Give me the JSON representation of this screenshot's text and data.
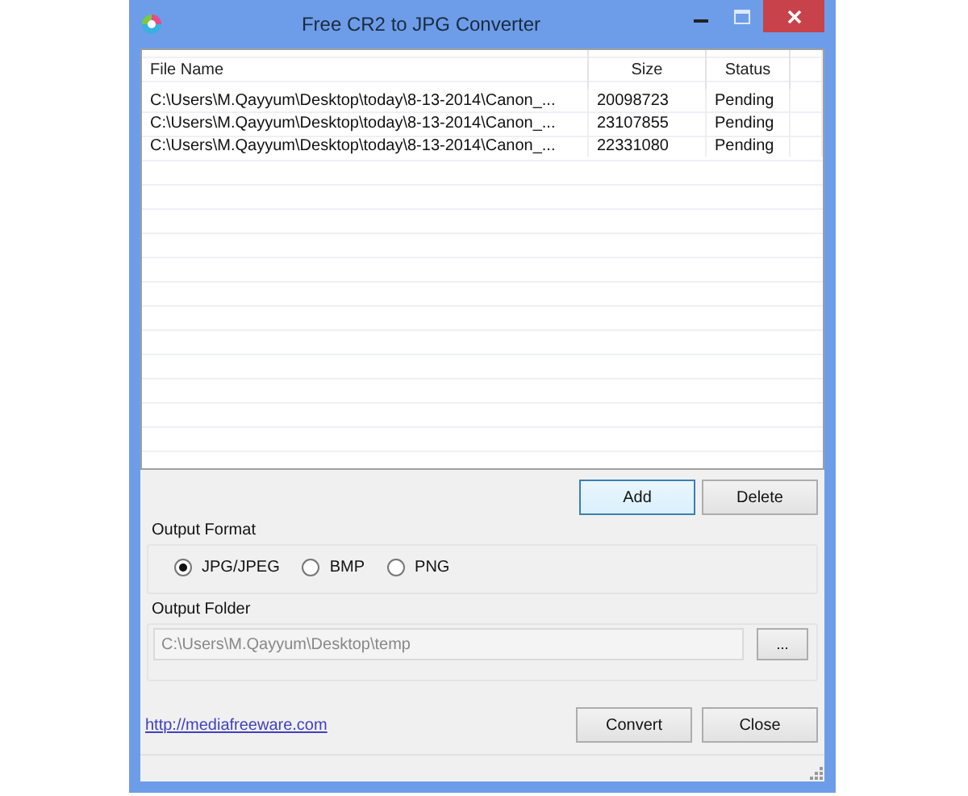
{
  "window": {
    "title": "Free CR2 to JPG Converter"
  },
  "table": {
    "columns": [
      "File Name",
      "Size",
      "Status"
    ],
    "rows": [
      [
        "C:\\Users\\M.Qayyum\\Desktop\\today\\8-13-2014\\Canon_...",
        "20098723",
        "Pending"
      ],
      [
        "C:\\Users\\M.Qayyum\\Desktop\\today\\8-13-2014\\Canon_...",
        "23107855",
        "Pending"
      ],
      [
        "C:\\Users\\M.Qayyum\\Desktop\\today\\8-13-2014\\Canon_...",
        "22331080",
        "Pending"
      ]
    ]
  },
  "list_buttons": [
    {
      "label": "Add",
      "focused": true
    },
    {
      "label": "Delete",
      "focused": false
    }
  ],
  "output_format": {
    "title": "Output Format",
    "options": [
      {
        "label": "JPG/JPEG",
        "selected": true
      },
      {
        "label": "BMP",
        "selected": false
      },
      {
        "label": "PNG",
        "selected": false
      }
    ]
  },
  "output_folder": {
    "title": "Output Folder",
    "value": "C:\\Users\\M.Qayyum\\Desktop\\temp",
    "browse": "..."
  },
  "link": "http://mediafreeware.com",
  "buttons": [
    {
      "label": "Convert",
      "focused": false
    },
    {
      "label": "Close",
      "focused": false
    }
  ]
}
